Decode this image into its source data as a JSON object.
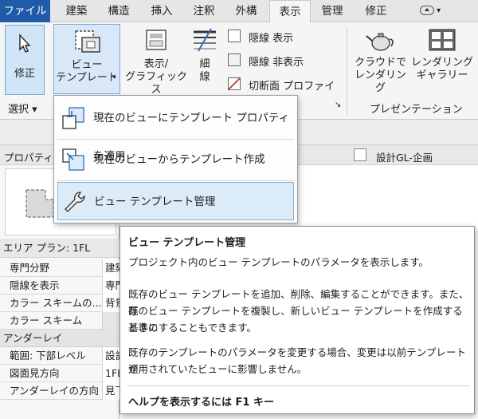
{
  "tabs": [
    "ファイル",
    "建築",
    "構造",
    "挿入",
    "注釈",
    "外構",
    "表示",
    "管理",
    "修正"
  ],
  "ribbon": {
    "modify_label": "修正",
    "select_label": "選択",
    "view_template_label_1": "ビュー",
    "view_template_label_2": "テンプレート",
    "display_graphics_label_1": "表示/",
    "display_graphics_label_2": "グラフィックス",
    "thin_line_label_1": "細",
    "thin_line_label_2": "線",
    "hidden_show": "隠線 表示",
    "hidden_hide": "隠線 非表示",
    "section_profile": "切断面 プロファイル",
    "cloud_render_1": "クラウドで",
    "cloud_render_2": "レンダリング",
    "render_gallery_1": "レンダリング",
    "render_gallery_2": "ギャラリー",
    "presentation_label": "プレゼンテーション"
  },
  "menu": {
    "items": [
      "現在のビューにテンプレート プロパティを適用",
      "現在のビューからテンプレート作成",
      "ビュー テンプレート管理"
    ]
  },
  "properties": {
    "header_label": "プロパティ",
    "view_tab_label": "設計GL-企画",
    "type_label": "エリア プラン: 1FL",
    "rows": [
      {
        "k": "専門分野",
        "v": "建築"
      },
      {
        "k": "隠線を表示",
        "v": "専門"
      },
      {
        "k": "カラー スキームの...",
        "v": "背景"
      },
      {
        "k": "カラー スキーム",
        "v": ""
      }
    ],
    "group_underlay": "アンダーレイ",
    "rows2": [
      {
        "k": "範囲: 下部レベル",
        "v": "設計"
      },
      {
        "k": "図面見方向",
        "v": "1FL"
      },
      {
        "k": "アンダーレイの方向",
        "v": "見下"
      }
    ]
  },
  "tooltip": {
    "title": "ビュー テンプレート管理",
    "line1": "プロジェクト内のビュー テンプレートのパラメータを表示します。",
    "para2_l1": "既存のビュー テンプレートを追加、削除、編集することができます。また、既",
    "para2_l2": "存のビュー テンプレートを複製し、新しいビュー テンプレートを作成するときの",
    "para2_l3": "基準にすることもできます。",
    "para3_l1": "既存のテンプレートのパラメータを変更する場合、変更は以前テンプレートが",
    "para3_l2": "適用されていたビューに影響しません。",
    "help": "ヘルプを表示するには F1 キー"
  },
  "colors": {
    "file_tab": "#1f5ba8",
    "highlight": "#dcebf8"
  }
}
